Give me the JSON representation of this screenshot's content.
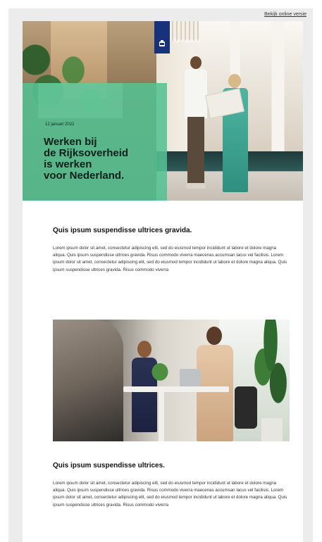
{
  "header": {
    "online_link": "Bekijk online versie"
  },
  "hero": {
    "logo_text": "Rijksoverheid",
    "date": "12 januari 2022",
    "headline": "Werken bij\nde Rijksoverheid\nis werken\nvoor Nederland."
  },
  "sections": [
    {
      "title": "Quis ipsum suspendisse ultrices gravida.",
      "body": "Lorem ipsum dolor sit amet, consectetur adipiscing elit, sed do eiusmod tempor incididunt ut labore et dolore magna aliqua. Quis ipsum suspendisse ultrices gravida. Risus commodo viverra maecenas accumsan lacus vel facilisis. Lorem ipsum dolor sit amet, consectetur adipiscing elit, sed do eiusmod tempor incididunt ut labore et dolore magna aliqua. Quis ipsum suspendisse ultrices gravida. Risus commodo viverra"
    },
    {
      "title": "Quis ipsum suspendisse ultrices.",
      "body": "Lorem ipsum dolor sit amet, consectetur adipiscing elit, sed do eiusmod tempor incididunt ut labore et dolore magna aliqua. Quis ipsum suspendisse ultrices gravida. Risus commodo viverra maecenas accumsan lacus vel facilisis. Lorem ipsum dolor sit amet, consectetur adipiscing elit, sed do eiusmod tempor incididunt ut labore et dolore magna aliqua. Quis ipsum suspendisse ultrices gravida. Risus commodo viverra"
    }
  ],
  "colors": {
    "brand_blue": "#17327a",
    "hero_green": "#54c193",
    "background": "#ececec"
  }
}
